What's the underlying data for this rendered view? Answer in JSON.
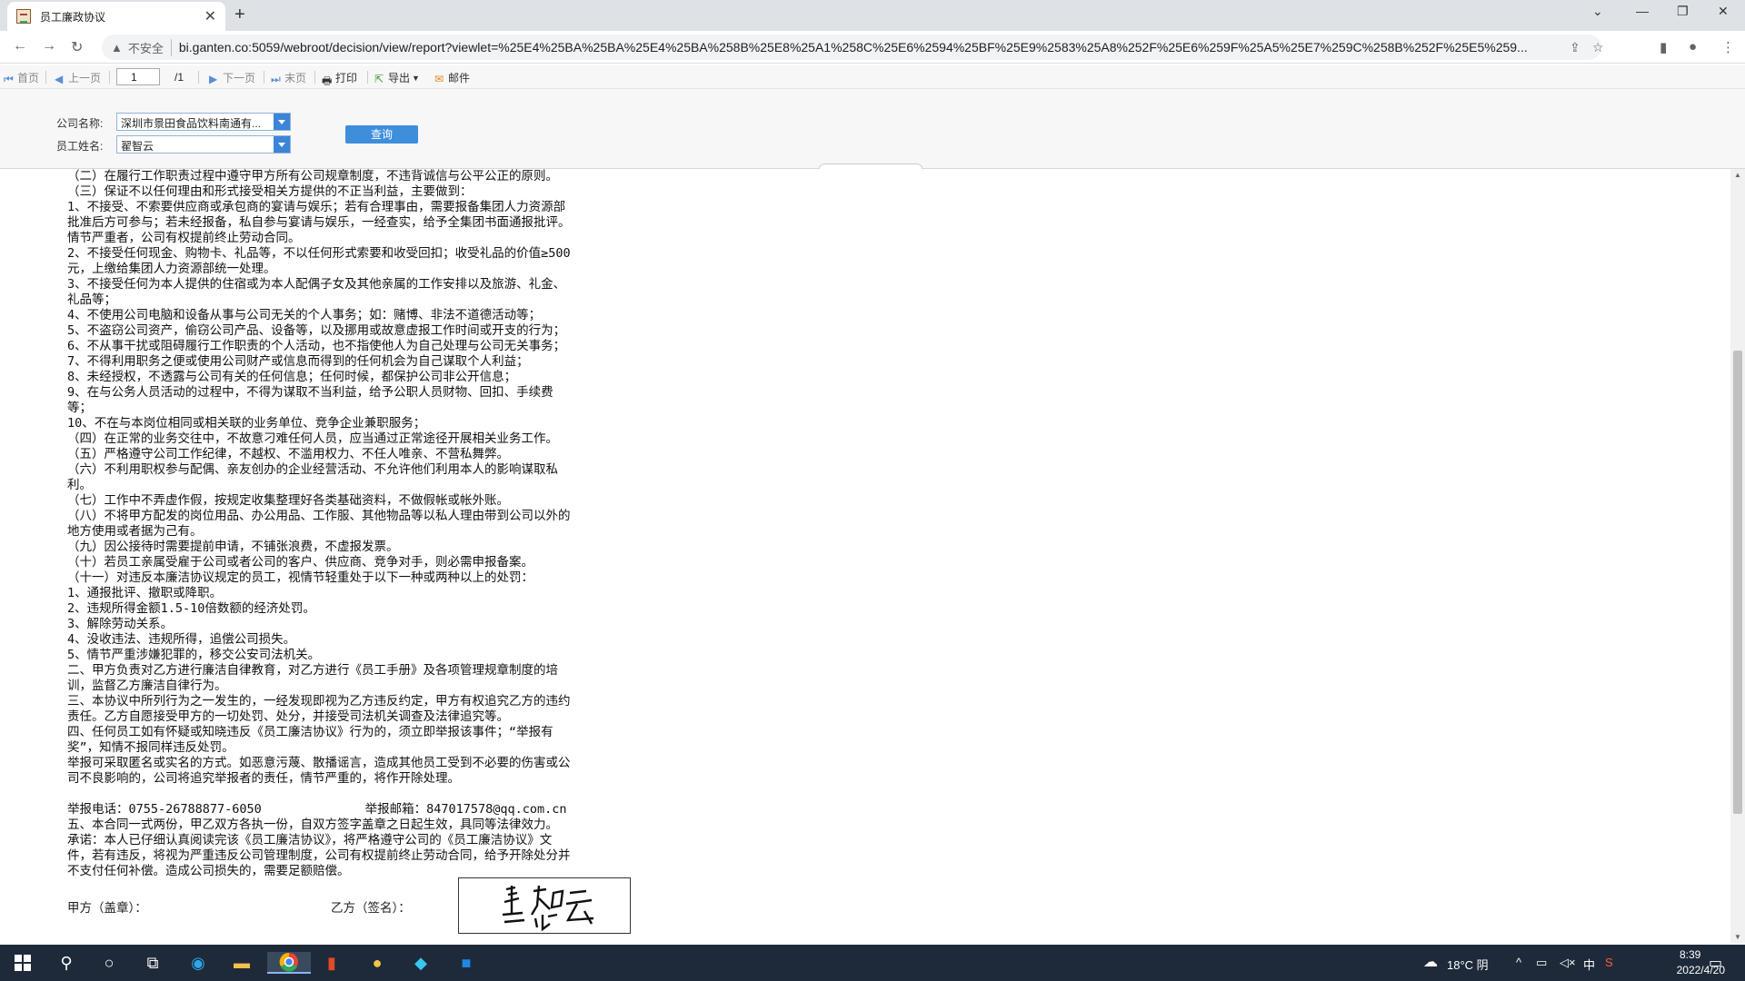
{
  "browser": {
    "tab_title": "员工廉政协议",
    "new_tab": "+",
    "insecure_label": "不安全",
    "url": "bi.ganten.co:5059/webroot/decision/view/report?viewlet=%25E4%25BA%25BA%25E4%25BA%258B%25E8%25A1%258C%25E6%2594%25BF%25E9%2583%25A8%252F%25E6%259F%25A5%25E7%259C%258B%252F%25E5%259..."
  },
  "toolbar": {
    "first": "首页",
    "prev": "上一页",
    "page": "1",
    "total": "/1",
    "next": "下一页",
    "last": "末页",
    "print": "打印",
    "export": "导出",
    "mail": "邮件"
  },
  "params": {
    "company_label": "公司名称:",
    "company_value": "深圳市景田食品饮料南通有...",
    "employee_label": "员工姓名:",
    "employee_value": "翟智云",
    "query": "查询"
  },
  "document": {
    "lines": [
      "（二）在履行工作职责过程中遵守甲方所有公司规章制度，不违背诚信与公平公正的原则。",
      "（三）保证不以任何理由和形式接受相关方提供的不正当利益，主要做到：",
      "1、不接受、不索要供应商或承包商的宴请与娱乐；若有合理事由，需要报备集团人力资源部",
      "批准后方可参与；若未经报备，私自参与宴请与娱乐，一经查实，给予全集团书面通报批评。",
      "情节严重者，公司有权提前终止劳动合同。",
      "2、不接受任何现金、购物卡、礼品等，不以任何形式索要和收受回扣；收受礼品的价值≥500",
      "元，上缴给集团人力资源部统一处理。",
      "3、不接受任何为本人提供的住宿或为本人配偶子女及其他亲属的工作安排以及旅游、礼金、",
      "礼品等；",
      "4、不使用公司电脑和设备从事与公司无关的个人事务；如：赌博、非法不道德活动等；",
      "5、不盗窃公司资产，偷窃公司产品、设备等，以及挪用或故意虚报工作时间或开支的行为；",
      "6、不从事干扰或阻碍履行工作职责的个人活动，也不指使他人为自己处理与公司无关事务；",
      "7、不得利用职务之便或使用公司财产或信息而得到的任何机会为自己谋取个人利益；",
      "8、未经授权，不透露与公司有关的任何信息；任何时候，都保护公司非公开信息；",
      "9、在与公务人员活动的过程中，不得为谋取不当利益，给予公职人员财物、回扣、手续费",
      "等；",
      "10、不在与本岗位相同或相关联的业务单位、竞争企业兼职服务；",
      "（四）在正常的业务交往中，不故意刁难任何人员，应当通过正常途径开展相关业务工作。",
      "（五）严格遵守公司工作纪律，不越权、不滥用权力、不任人唯亲、不营私舞弊。",
      "（六）不利用职权参与配偶、亲友创办的企业经营活动、不允许他们利用本人的影响谋取私",
      "利。",
      "（七）工作中不弄虚作假，按规定收集整理好各类基础资料，不做假帐或帐外账。",
      "（八）不将甲方配发的岗位用品、办公用品、工作服、其他物品等以私人理由带到公司以外的",
      "地方使用或者据为己有。",
      "（九）因公接待时需要提前申请，不铺张浪费，不虚报发票。",
      "（十）若员工亲属受雇于公司或者公司的客户、供应商、竞争对手，则必需申报备案。",
      "（十一）对违反本廉洁协议规定的员工，视情节轻重处于以下一种或两种以上的处罚：",
      "1、通报批评、撤职或降职。",
      "2、违规所得金额1.5-10倍数额的经济处罚。",
      "3、解除劳动关系。",
      "4、没收违法、违规所得，追偿公司损失。",
      "5、情节严重涉嫌犯罪的，移交公安司法机关。",
      "二、甲方负责对乙方进行廉洁自律教育，对乙方进行《员工手册》及各项管理规章制度的培",
      "训，监督乙方廉洁自律行为。",
      "三、本协议中所列行为之一发生的，一经发现即视为乙方违反约定，甲方有权追究乙方的违约",
      "责任。乙方自愿接受甲方的一切处罚、处分，并接受司法机关调查及法律追究等。",
      "四、任何员工如有怀疑或知晓违反《员工廉洁协议》行为的，须立即举报该事件；“举报有",
      "奖”，知情不报同样违反处罚。",
      "举报可采取匿名或实名的方式。如恶意污蔑、散播谣言，造成其他员工受到不必要的伤害或公",
      "司不良影响的，公司将追究举报者的责任，情节严重的，将作开除处理。",
      "",
      "举报电话：0755-26788877-6050              举报邮箱：847017578@qq.com.cn",
      "五、本合同一式两份，甲乙双方各执一份，自双方签字盖章之日起生效，具同等法律效力。",
      "承诺：本人已仔细认真阅读完该《员工廉洁协议》，将严格遵守公司的《员工廉洁协议》文",
      "件，若有违反，将视为严重违反公司管理制度，公司有权提前终止劳动合同，给予开除处分并",
      "不支付任何补偿。造成公司损失的，需要足额赔偿。"
    ],
    "party_a": "甲方（盖章）：",
    "party_b": "乙方（签名）："
  },
  "taskbar": {
    "weather": "18°C 阴",
    "ime": "中",
    "time": "8:39",
    "date": "2022/4/20"
  }
}
